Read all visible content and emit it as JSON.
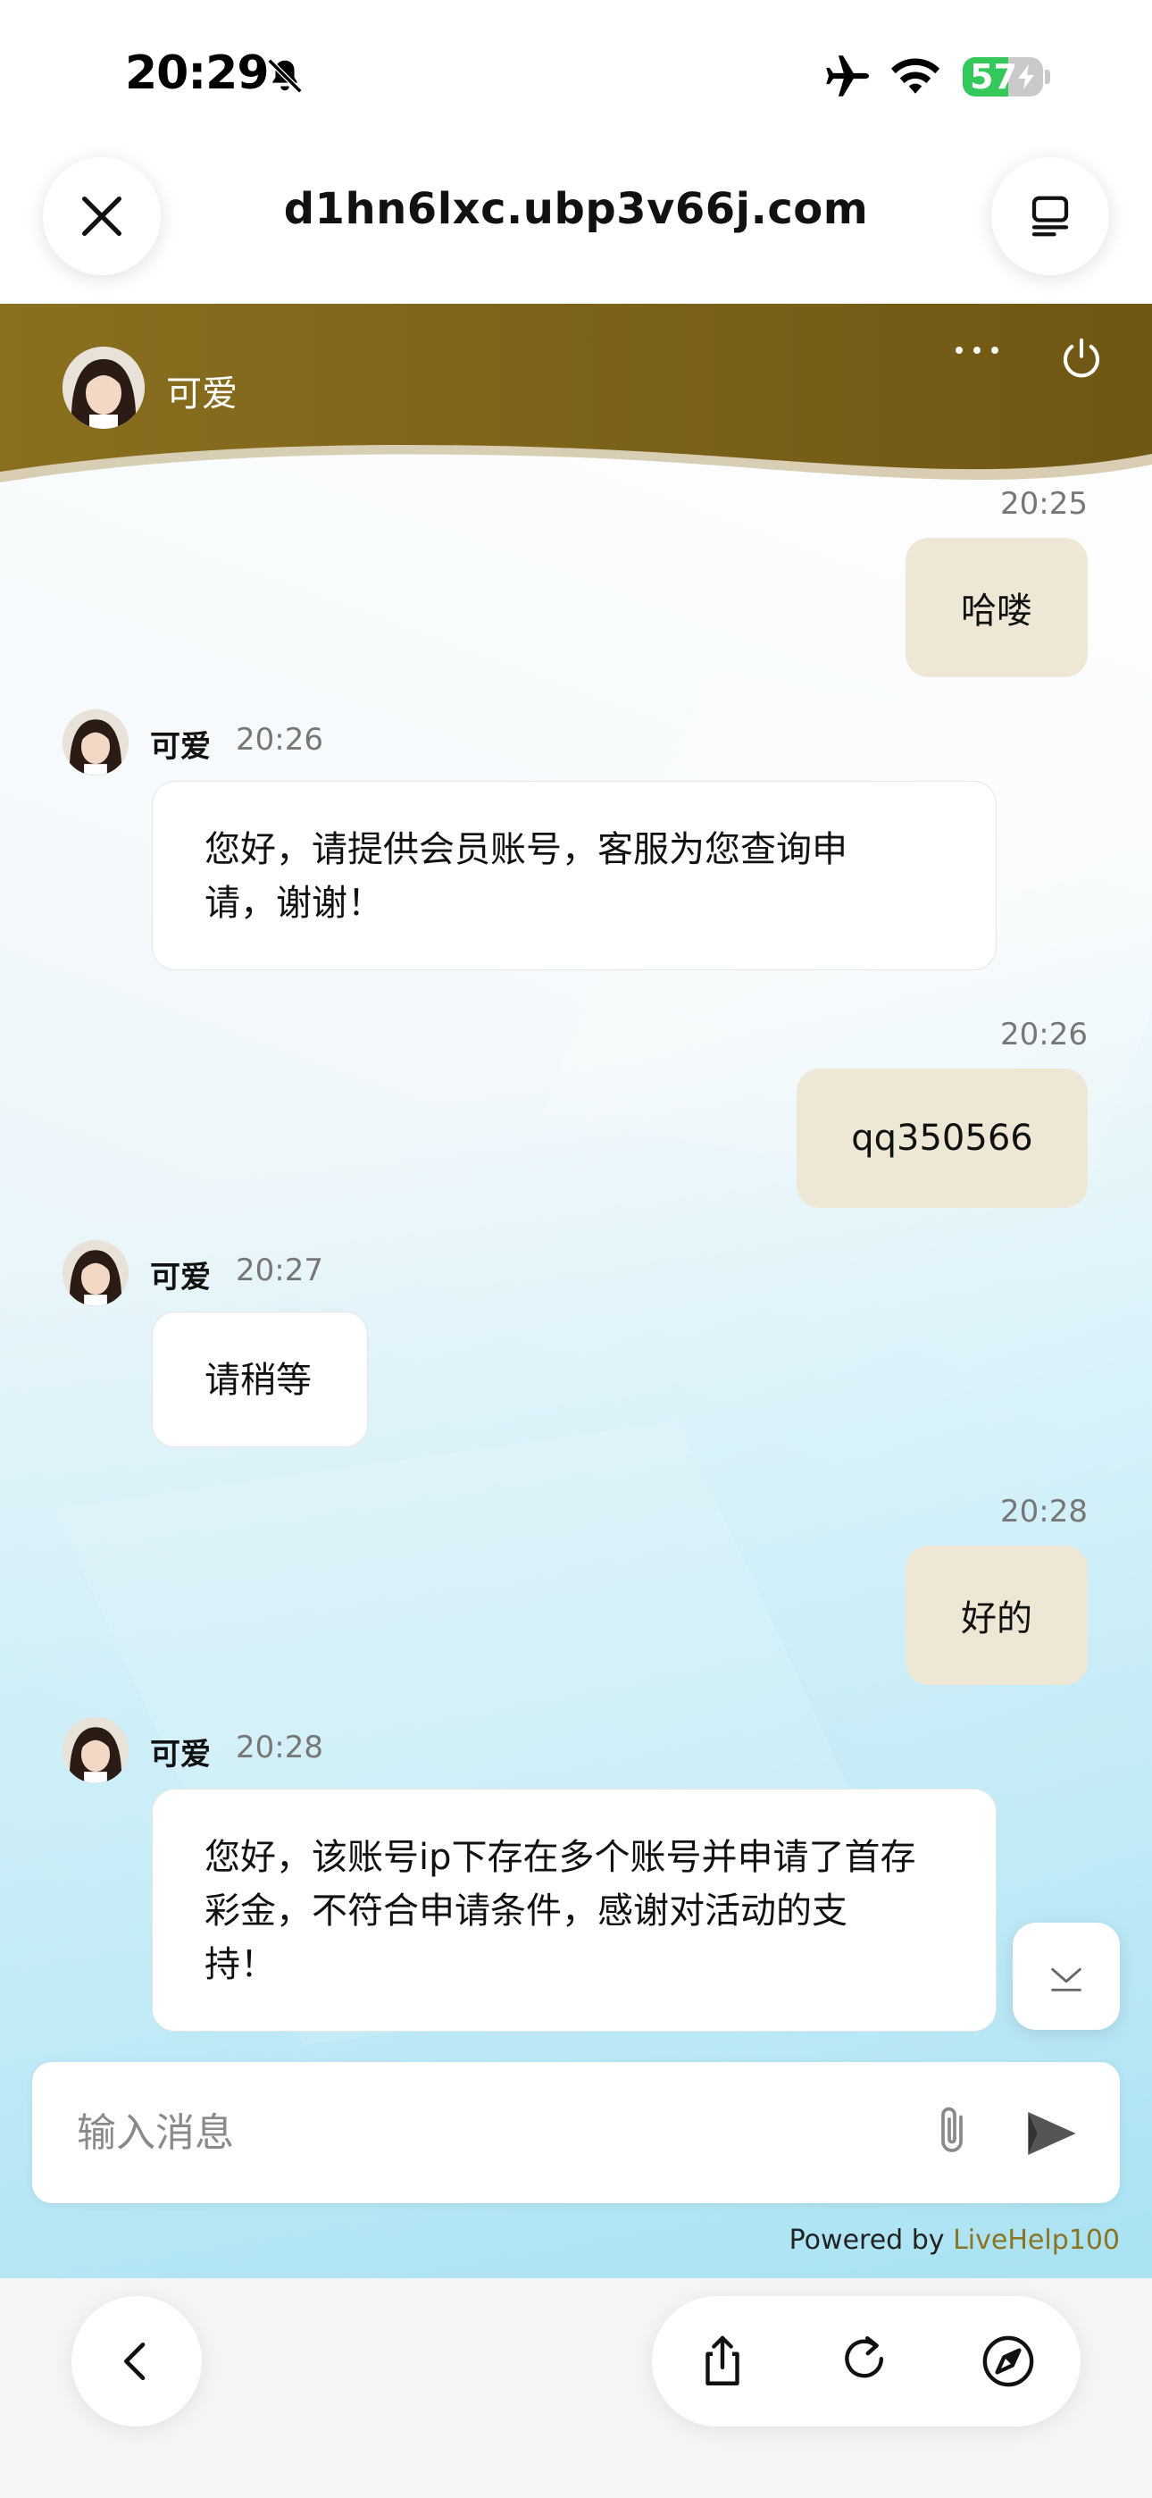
{
  "status_bar": {
    "time": "20:29",
    "battery_level": "57",
    "icons": [
      "bell-slash-icon",
      "airplane-icon",
      "wifi-icon",
      "battery-charging-icon"
    ]
  },
  "browser": {
    "url": "d1hn6lxc.ubp3v66j.com",
    "icons": [
      "close-icon",
      "tabs-icon",
      "back-icon",
      "share-icon",
      "reload-icon",
      "compass-icon"
    ]
  },
  "chat": {
    "header": {
      "agent_name": "可爱",
      "icons": [
        "more-icon",
        "power-icon"
      ]
    },
    "messages": [
      {
        "direction": "out",
        "time": "20:25",
        "text": "哈喽"
      },
      {
        "direction": "in",
        "sender": "可爱",
        "time": "20:26",
        "lines": [
          "您好，请提供会员账号，客服为您查询申",
          "请，谢谢！"
        ]
      },
      {
        "direction": "out",
        "time": "20:26",
        "text": "qq350566"
      },
      {
        "direction": "in",
        "sender": "可爱",
        "time": "20:27",
        "lines": [
          "请稍等"
        ]
      },
      {
        "direction": "out",
        "time": "20:28",
        "text": "好的"
      },
      {
        "direction": "in",
        "sender": "可爱",
        "time": "20:28",
        "lines": [
          "您好，该账号ip下存在多个账号并申请了首存",
          "彩金，不符合申请条件，感谢对活动的支",
          "持！"
        ]
      }
    ],
    "input": {
      "placeholder": "输入消息",
      "value": ""
    },
    "powered_by": {
      "prefix": "Powered by ",
      "brand": "LiveHelp100"
    },
    "colors": {
      "header": "#7c6318",
      "bubble_out": "#efe7d6",
      "brand": "#8a7424"
    }
  }
}
